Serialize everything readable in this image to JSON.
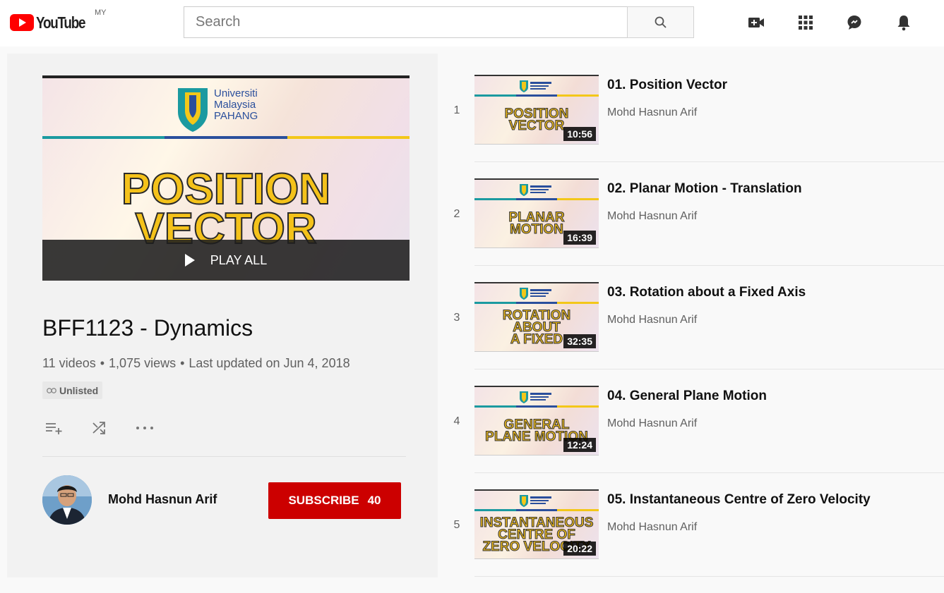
{
  "header": {
    "logo_text": "YouTube",
    "country": "MY",
    "search_placeholder": "Search",
    "icons": [
      "search-icon",
      "create-video-icon",
      "apps-grid-icon",
      "messages-icon",
      "notifications-bell-icon"
    ]
  },
  "playlist": {
    "hero": {
      "university": [
        "Universiti",
        "Malaysia",
        "PAHANG"
      ],
      "title_lines": [
        "POSITION",
        "VECTOR"
      ],
      "play_all": "PLAY ALL"
    },
    "title": "BFF1123 - Dynamics",
    "video_count": "11 videos",
    "views": "1,075 views",
    "updated": "Last updated on Jun 4, 2018",
    "privacy": "Unlisted",
    "owner": "Mohd Hasnun Arif",
    "subscribe_label": "Subscribe",
    "subscriber_count": "40"
  },
  "videos": [
    {
      "index": "1",
      "title": "01. Position Vector",
      "channel": "Mohd Hasnun Arif",
      "duration": "10:56",
      "thumb_lines": [
        "POSITION",
        "VECTOR"
      ]
    },
    {
      "index": "2",
      "title": "02. Planar Motion - Translation",
      "channel": "Mohd Hasnun Arif",
      "duration": "16:39",
      "thumb_lines": [
        "PLANAR",
        "MOTION"
      ]
    },
    {
      "index": "3",
      "title": "03. Rotation about a Fixed Axis",
      "channel": "Mohd Hasnun Arif",
      "duration": "32:35",
      "thumb_lines": [
        "ROTATION",
        "ABOUT",
        "A FIXED"
      ]
    },
    {
      "index": "4",
      "title": "04. General Plane Motion",
      "channel": "Mohd Hasnun Arif",
      "duration": "12:24",
      "thumb_lines": [
        "GENERAL",
        "PLANE MOTION"
      ]
    },
    {
      "index": "5",
      "title": "05. Instantaneous Centre of Zero Velocity",
      "channel": "Mohd Hasnun Arif",
      "duration": "20:22",
      "thumb_lines": [
        "INSTANTANEOUS",
        "CENTRE OF",
        "ZERO VELOCITY"
      ]
    }
  ],
  "colors": {
    "brand_red": "#ff0000",
    "subscribe_red": "#cc0000",
    "band_teal": "#1b9aa0",
    "band_blue": "#2a4f9c",
    "band_yellow": "#f3c719",
    "thumb_title_gold": "#f4c21a"
  }
}
